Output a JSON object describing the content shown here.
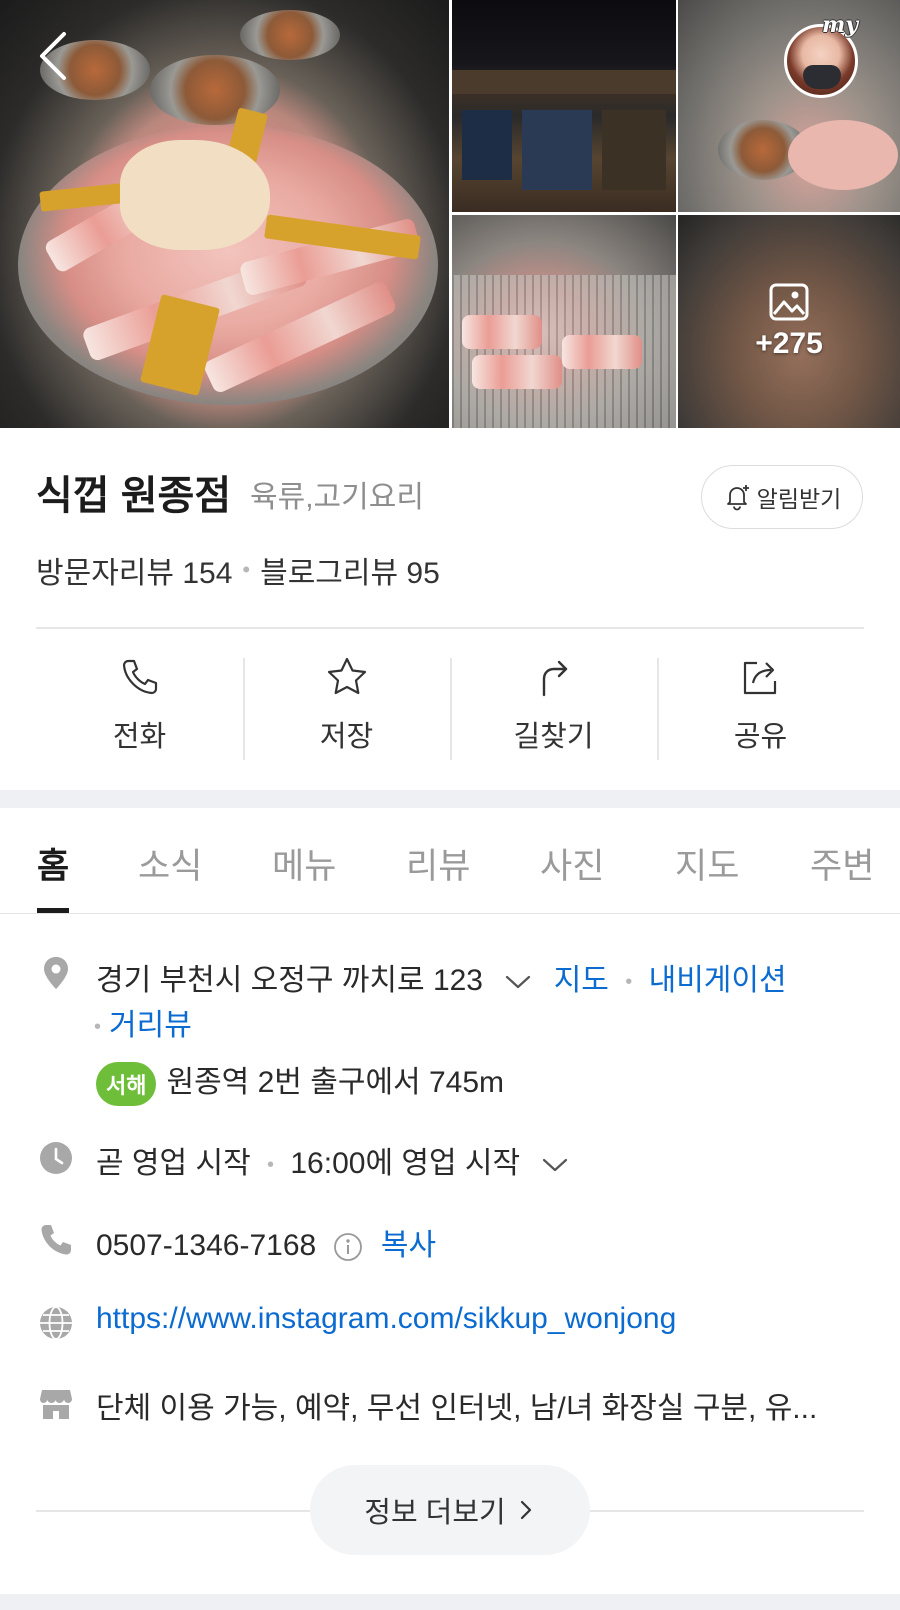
{
  "photos": {
    "more_count": "+275"
  },
  "profile": {
    "badge_text": "my"
  },
  "place": {
    "name": "식껍 원종점",
    "category": "육류,고기요리",
    "alarm_label": "알림받기",
    "visitor_reviews": "방문자리뷰 154",
    "blog_reviews": "블로그리뷰 95"
  },
  "actions": [
    {
      "label": "전화",
      "icon": "phone-icon"
    },
    {
      "label": "저장",
      "icon": "star-icon"
    },
    {
      "label": "길찾기",
      "icon": "directions-icon"
    },
    {
      "label": "공유",
      "icon": "share-icon"
    }
  ],
  "tabs": [
    "홈",
    "소식",
    "메뉴",
    "리뷰",
    "사진",
    "지도",
    "주변"
  ],
  "active_tab": "홈",
  "info": {
    "address": "경기 부천시 오정구 까치로 123",
    "map_link": "지도",
    "navigation_link": "내비게이션",
    "street_view_link": "거리뷰",
    "subway_line": "서해",
    "subway_directions": "원종역 2번 출구에서 745m",
    "hours_status": "곧 영업 시작",
    "hours_detail": "16:00에 영업 시작",
    "phone": "0507-1346-7168",
    "copy_label": "복사",
    "website": "https://www.instagram.com/sikkup_wonjong",
    "amenities": "단체 이용 가능, 예약, 무선 인터넷, 남/녀 화장실 구분, 유...",
    "more_info_label": "정보 더보기"
  },
  "colors": {
    "link": "#0b6bd0",
    "subway_badge": "#6fbe3a",
    "text": "#222222",
    "muted": "#9a9a9a"
  }
}
